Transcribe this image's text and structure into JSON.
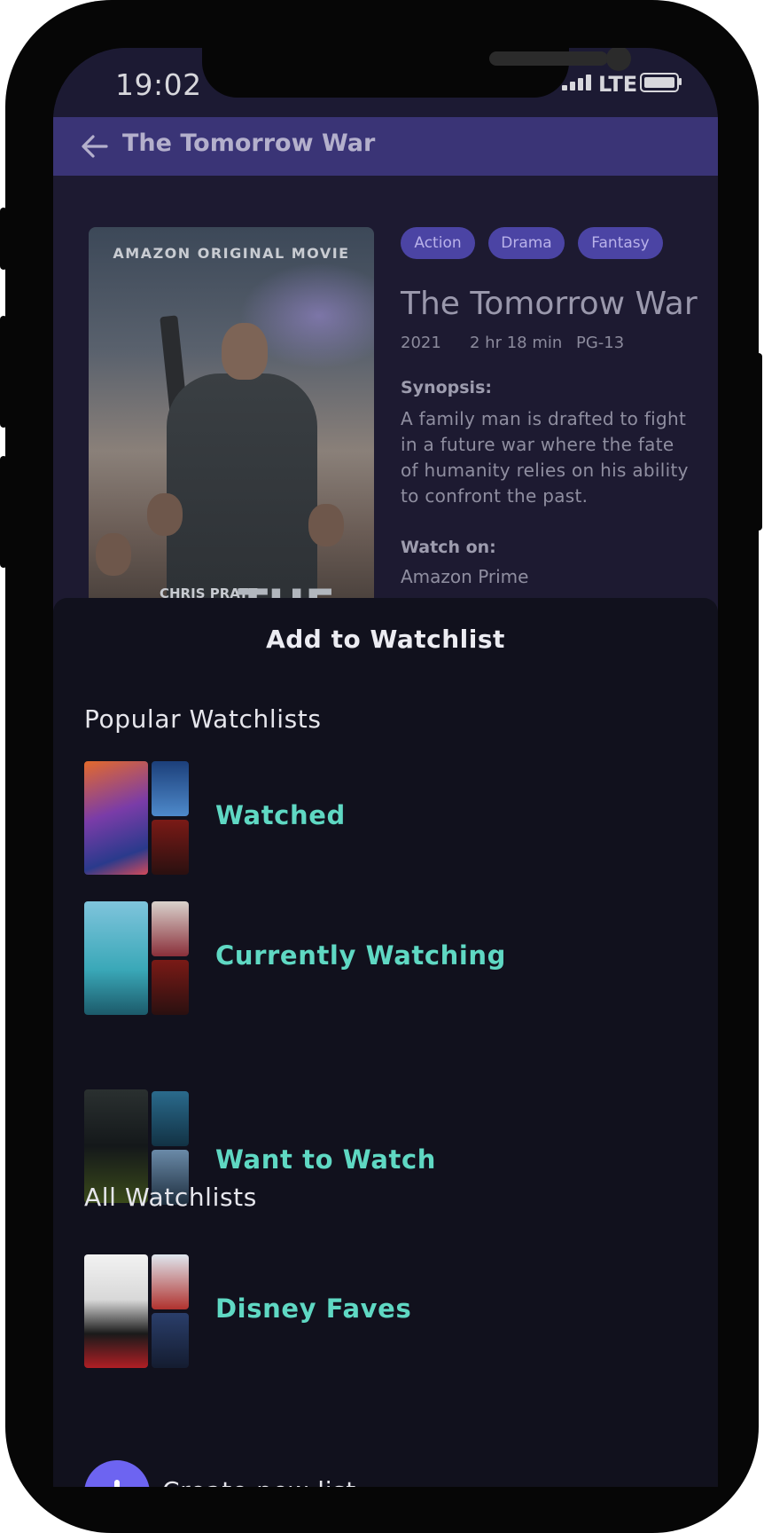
{
  "status_bar": {
    "time": "19:02",
    "network": "LTE"
  },
  "app_bar": {
    "title": "The Tomorrow War"
  },
  "poster": {
    "top_text": "AMAZON ORIGINAL MOVIE",
    "actor": "CHRIS PRATT",
    "big_text": "THE"
  },
  "movie": {
    "genres": [
      "Action",
      "Drama",
      "Fantasy"
    ],
    "title": "The Tomorrow War",
    "year": "2021",
    "runtime": "2 hr 18 min",
    "rating": "PG-13",
    "synopsis_label": "Synopsis:",
    "synopsis": "A family man is drafted to fight in a future war where the fate of humanity relies on his ability to confront the past.",
    "watch_on_label": "Watch on:",
    "provider": "Amazon Prime"
  },
  "sheet": {
    "title": "Add to Watchlist",
    "popular_heading": "Popular Watchlists",
    "popular": [
      {
        "name": "Watched"
      },
      {
        "name": "Currently Watching"
      },
      {
        "name": "Want to Watch"
      }
    ],
    "all_heading": "All Watchlists",
    "all": [
      {
        "name": "Disney Faves"
      }
    ],
    "create_label": "Create new list"
  },
  "colors": {
    "accent": "#6d64f1",
    "watchlist_text": "#5fd8c3",
    "chip_bg": "#4b44a4",
    "app_bar_bg": "#3a3476"
  }
}
